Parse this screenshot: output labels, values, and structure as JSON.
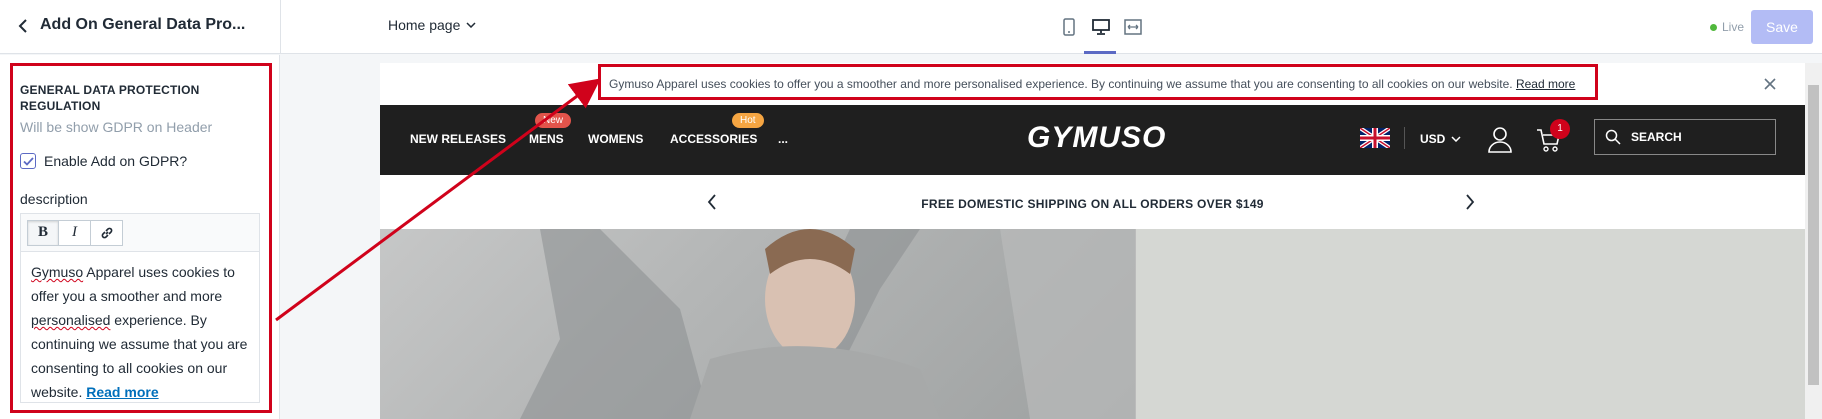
{
  "topbar": {
    "title": "Add On General Data Pro...",
    "page_select": "Home page",
    "status": "Live",
    "save_label": "Save"
  },
  "sidebar": {
    "section_title": "GENERAL DATA PROTECTION REGULATION",
    "section_sub": "Will be show GDPR on Header",
    "checkbox_label": "Enable Add on GDPR?",
    "checkbox_checked": true,
    "description_label": "description",
    "toolbar": {
      "bold": "B",
      "italic": "I"
    },
    "editor": {
      "w_gymuso": "Gymuso",
      "t1": " Apparel uses cookies to offer you a smoother and more ",
      "w_personalised": "personalised",
      "t2": " experience. By continuing we assume that you are consenting to all cookies on our website. ",
      "read_more": "Read more"
    }
  },
  "preview": {
    "cookie_text": "Gymuso Apparel uses cookies to offer you a smoother and more personalised experience. By continuing we assume that you are consenting to all cookies on our website.",
    "cookie_link": "Read more",
    "nav": {
      "items": [
        "NEW RELEASES",
        "MENS",
        "WOMENS",
        "ACCESSORIES",
        "..."
      ],
      "badge_new": "New",
      "badge_hot": "Hot",
      "logo": "GYMUSO",
      "currency": "USD",
      "cart_count": "1",
      "search_placeholder": "SEARCH"
    },
    "announcement": "FREE DOMESTIC SHIPPING ON ALL ORDERS OVER $149"
  },
  "colors": {
    "accent": "#5c6ac4",
    "annotation_red": "#d0021b",
    "nav_bg": "#1f1f1f",
    "badge_new": "#e2544b",
    "badge_hot": "#f5a542"
  }
}
